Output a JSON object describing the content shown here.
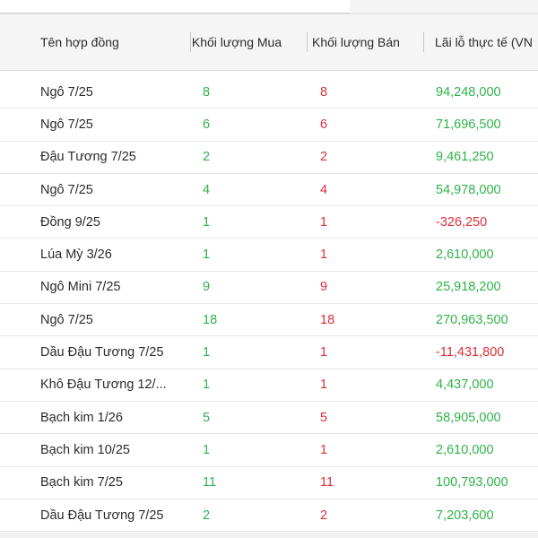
{
  "table": {
    "columns": {
      "name": "Tên hợp đồng",
      "buy": "Khối lượng Mua",
      "sell": "Khối lượng Bán",
      "pnl": "Lãi lỗ thực tế (VN"
    },
    "rows": [
      {
        "name": "Ngô 7/25",
        "buy": "8",
        "sell": "8",
        "pnl": "94,248,000",
        "pnl_sign": "positive"
      },
      {
        "name": "Ngô 7/25",
        "buy": "6",
        "sell": "6",
        "pnl": "71,696,500",
        "pnl_sign": "positive"
      },
      {
        "name": "Đậu Tương 7/25",
        "buy": "2",
        "sell": "2",
        "pnl": "9,461,250",
        "pnl_sign": "positive"
      },
      {
        "name": "Ngô 7/25",
        "buy": "4",
        "sell": "4",
        "pnl": "54,978,000",
        "pnl_sign": "positive"
      },
      {
        "name": "Đồng 9/25",
        "buy": "1",
        "sell": "1",
        "pnl": "-326,250",
        "pnl_sign": "negative"
      },
      {
        "name": "Lúa Mỳ 3/26",
        "buy": "1",
        "sell": "1",
        "pnl": "2,610,000",
        "pnl_sign": "positive"
      },
      {
        "name": "Ngô Mini 7/25",
        "buy": "9",
        "sell": "9",
        "pnl": "25,918,200",
        "pnl_sign": "positive"
      },
      {
        "name": "Ngô 7/25",
        "buy": "18",
        "sell": "18",
        "pnl": "270,963,500",
        "pnl_sign": "positive"
      },
      {
        "name": "Dầu Đậu Tương 7/25",
        "buy": "1",
        "sell": "1",
        "pnl": "-11,431,800",
        "pnl_sign": "negative"
      },
      {
        "name": "Khô Đậu Tương 12/...",
        "buy": "1",
        "sell": "1",
        "pnl": "4,437,000",
        "pnl_sign": "positive"
      },
      {
        "name": "Bạch kim 1/26",
        "buy": "5",
        "sell": "5",
        "pnl": "58,905,000",
        "pnl_sign": "positive"
      },
      {
        "name": "Bạch kim 10/25",
        "buy": "1",
        "sell": "1",
        "pnl": "2,610,000",
        "pnl_sign": "positive"
      },
      {
        "name": "Bạch kim 7/25",
        "buy": "11",
        "sell": "11",
        "pnl": "100,793,000",
        "pnl_sign": "positive"
      },
      {
        "name": "Dầu Đậu Tương 7/25",
        "buy": "2",
        "sell": "2",
        "pnl": "7,203,600",
        "pnl_sign": "positive"
      }
    ]
  },
  "colors": {
    "buy": "#2fb24a",
    "sell": "#dd2f3b",
    "profit": "#2fb24a",
    "loss": "#dd2f3b"
  }
}
